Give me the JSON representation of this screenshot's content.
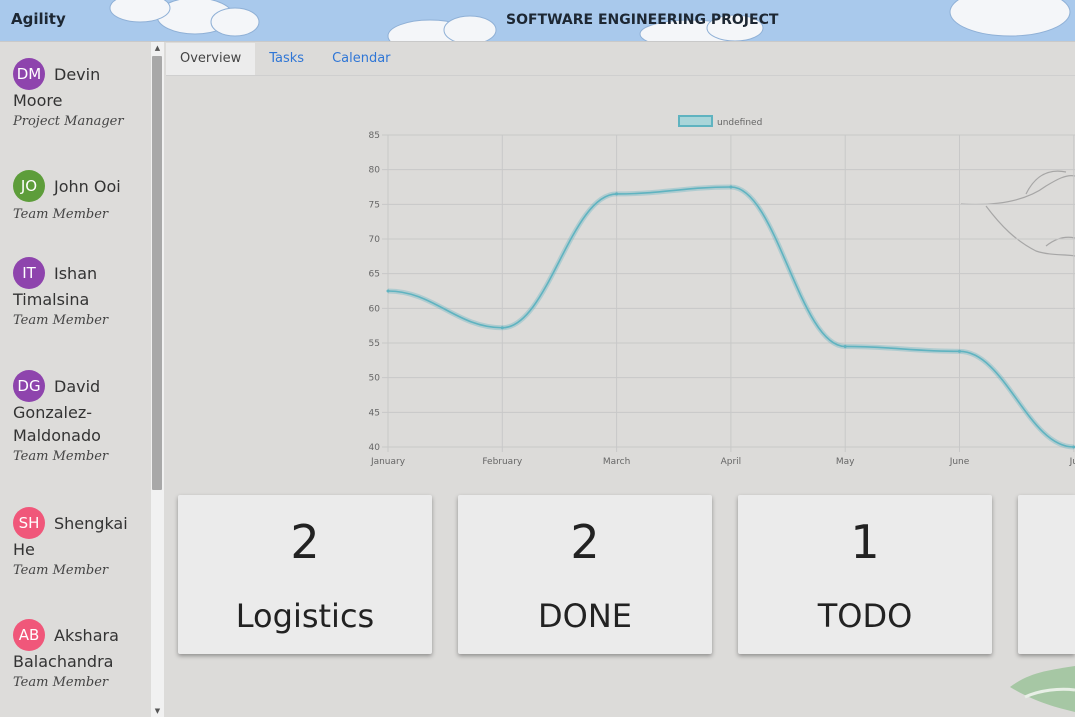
{
  "app": {
    "name": "Agility",
    "project_title": "SOFTWARE ENGINEERING PROJECT"
  },
  "tabs": [
    {
      "label": "Overview",
      "active": true
    },
    {
      "label": "Tasks",
      "active": false
    },
    {
      "label": "Calendar",
      "active": false
    }
  ],
  "members": [
    {
      "initials": "DM",
      "first": "Devin",
      "rest": [
        "Moore"
      ],
      "role": "Project Manager",
      "color": "#8e44ad"
    },
    {
      "initials": "JO",
      "first": "John Ooi",
      "rest": [],
      "role": "Team Member",
      "color": "#5d9d3a"
    },
    {
      "initials": "IT",
      "first": "Ishan",
      "rest": [
        "Timalsina"
      ],
      "role": "Team Member",
      "color": "#8e44ad"
    },
    {
      "initials": "DG",
      "first": "David",
      "rest": [
        "Gonzalez-",
        "Maldonado"
      ],
      "role": "Team Member",
      "color": "#8e44ad"
    },
    {
      "initials": "SH",
      "first": "Shengkai",
      "rest": [
        "He"
      ],
      "role": "Team Member",
      "color": "#f0577a"
    },
    {
      "initials": "AB",
      "first": "Akshara",
      "rest": [
        "Balachandra"
      ],
      "role": "Team Member",
      "color": "#f0577a"
    }
  ],
  "chart_data": {
    "type": "line",
    "categories": [
      "January",
      "February",
      "March",
      "April",
      "May",
      "June",
      "July"
    ],
    "visible_x_labels": [
      "January",
      "February",
      "March",
      "April",
      "May",
      "June",
      "Ju"
    ],
    "series": [
      {
        "name": "undefined",
        "values": [
          62.5,
          57.2,
          76.5,
          77.5,
          54.5,
          53.8,
          40.0
        ]
      }
    ],
    "ylim": [
      40,
      85
    ],
    "yticks": [
      40,
      45,
      50,
      55,
      60,
      65,
      70,
      75,
      80,
      85
    ],
    "grid": true,
    "legend": "top-center",
    "color": "#5fb3c0"
  },
  "cards": [
    {
      "count": "2",
      "label": "Logistics"
    },
    {
      "count": "2",
      "label": "DONE"
    },
    {
      "count": "1",
      "label": "TODO"
    },
    {
      "count": "",
      "label": ""
    }
  ]
}
